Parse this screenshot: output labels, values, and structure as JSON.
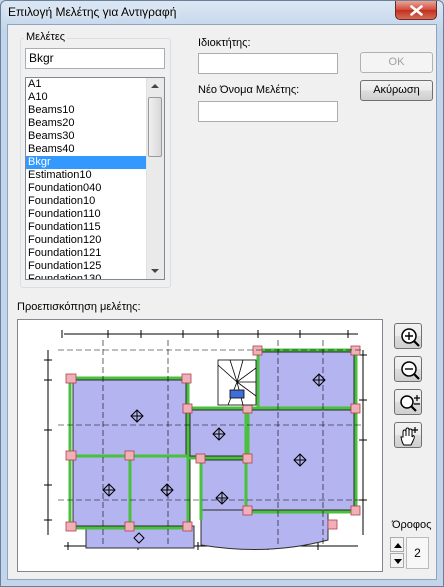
{
  "window": {
    "title": "Επιλογή Μελέτης για Αντιγραφή"
  },
  "studies": {
    "group_label": "Μελέτες",
    "filter_value": "Bkgr",
    "items": [
      "A1",
      "A10",
      "Beams10",
      "Beams20",
      "Beams30",
      "Beams40",
      "Bkgr",
      "Estimation10",
      "Foundation040",
      "Foundation10",
      "Foundation110",
      "Foundation115",
      "Foundation120",
      "Foundation121",
      "Foundation125",
      "Foundation130"
    ],
    "selected": "Bkgr"
  },
  "owner": {
    "label": "Ιδιοκτήτης:",
    "value": ""
  },
  "new_name": {
    "label": "Νέο Όνομα Μελέτης:",
    "value": ""
  },
  "buttons": {
    "ok": "OK",
    "cancel": "Ακύρωση"
  },
  "preview": {
    "label": "Προεπισκόπηση μελέτης:"
  },
  "tools": [
    "zoom-in-icon",
    "zoom-out-icon",
    "zoom-extents-icon",
    "pan-hand-icon"
  ],
  "floor": {
    "label": "Όροφος",
    "value": "2"
  },
  "colors": {
    "slab_fill": "#b4b4f0",
    "beam_green": "#49c13c",
    "column_pink": "#f0b0b8",
    "selection": "#3399ff"
  }
}
